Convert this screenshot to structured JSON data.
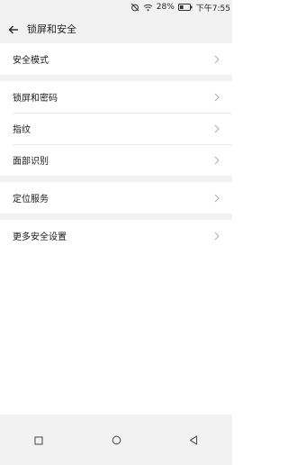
{
  "status_bar": {
    "battery": "28%",
    "time": "下午7:55",
    "icons": [
      "alarm-off-icon",
      "wifi-icon",
      "battery-icon"
    ]
  },
  "header": {
    "title": "锁屏和安全",
    "back_icon": "arrow-left-icon"
  },
  "groups": [
    {
      "items": [
        {
          "label": "安全模式"
        }
      ]
    },
    {
      "items": [
        {
          "label": "锁屏和密码"
        },
        {
          "label": "指纹"
        },
        {
          "label": "面部识别"
        }
      ]
    },
    {
      "items": [
        {
          "label": "定位服务"
        }
      ]
    },
    {
      "items": [
        {
          "label": "更多安全设置"
        }
      ]
    }
  ],
  "nav_bar": {
    "buttons": [
      "recents-square-icon",
      "home-circle-icon",
      "back-triangle-icon"
    ]
  },
  "colors": {
    "background": "#ffffff",
    "bar_background": "#f2f2f2",
    "separator": "#ebebeb",
    "chevron": "#b0b0b0"
  }
}
